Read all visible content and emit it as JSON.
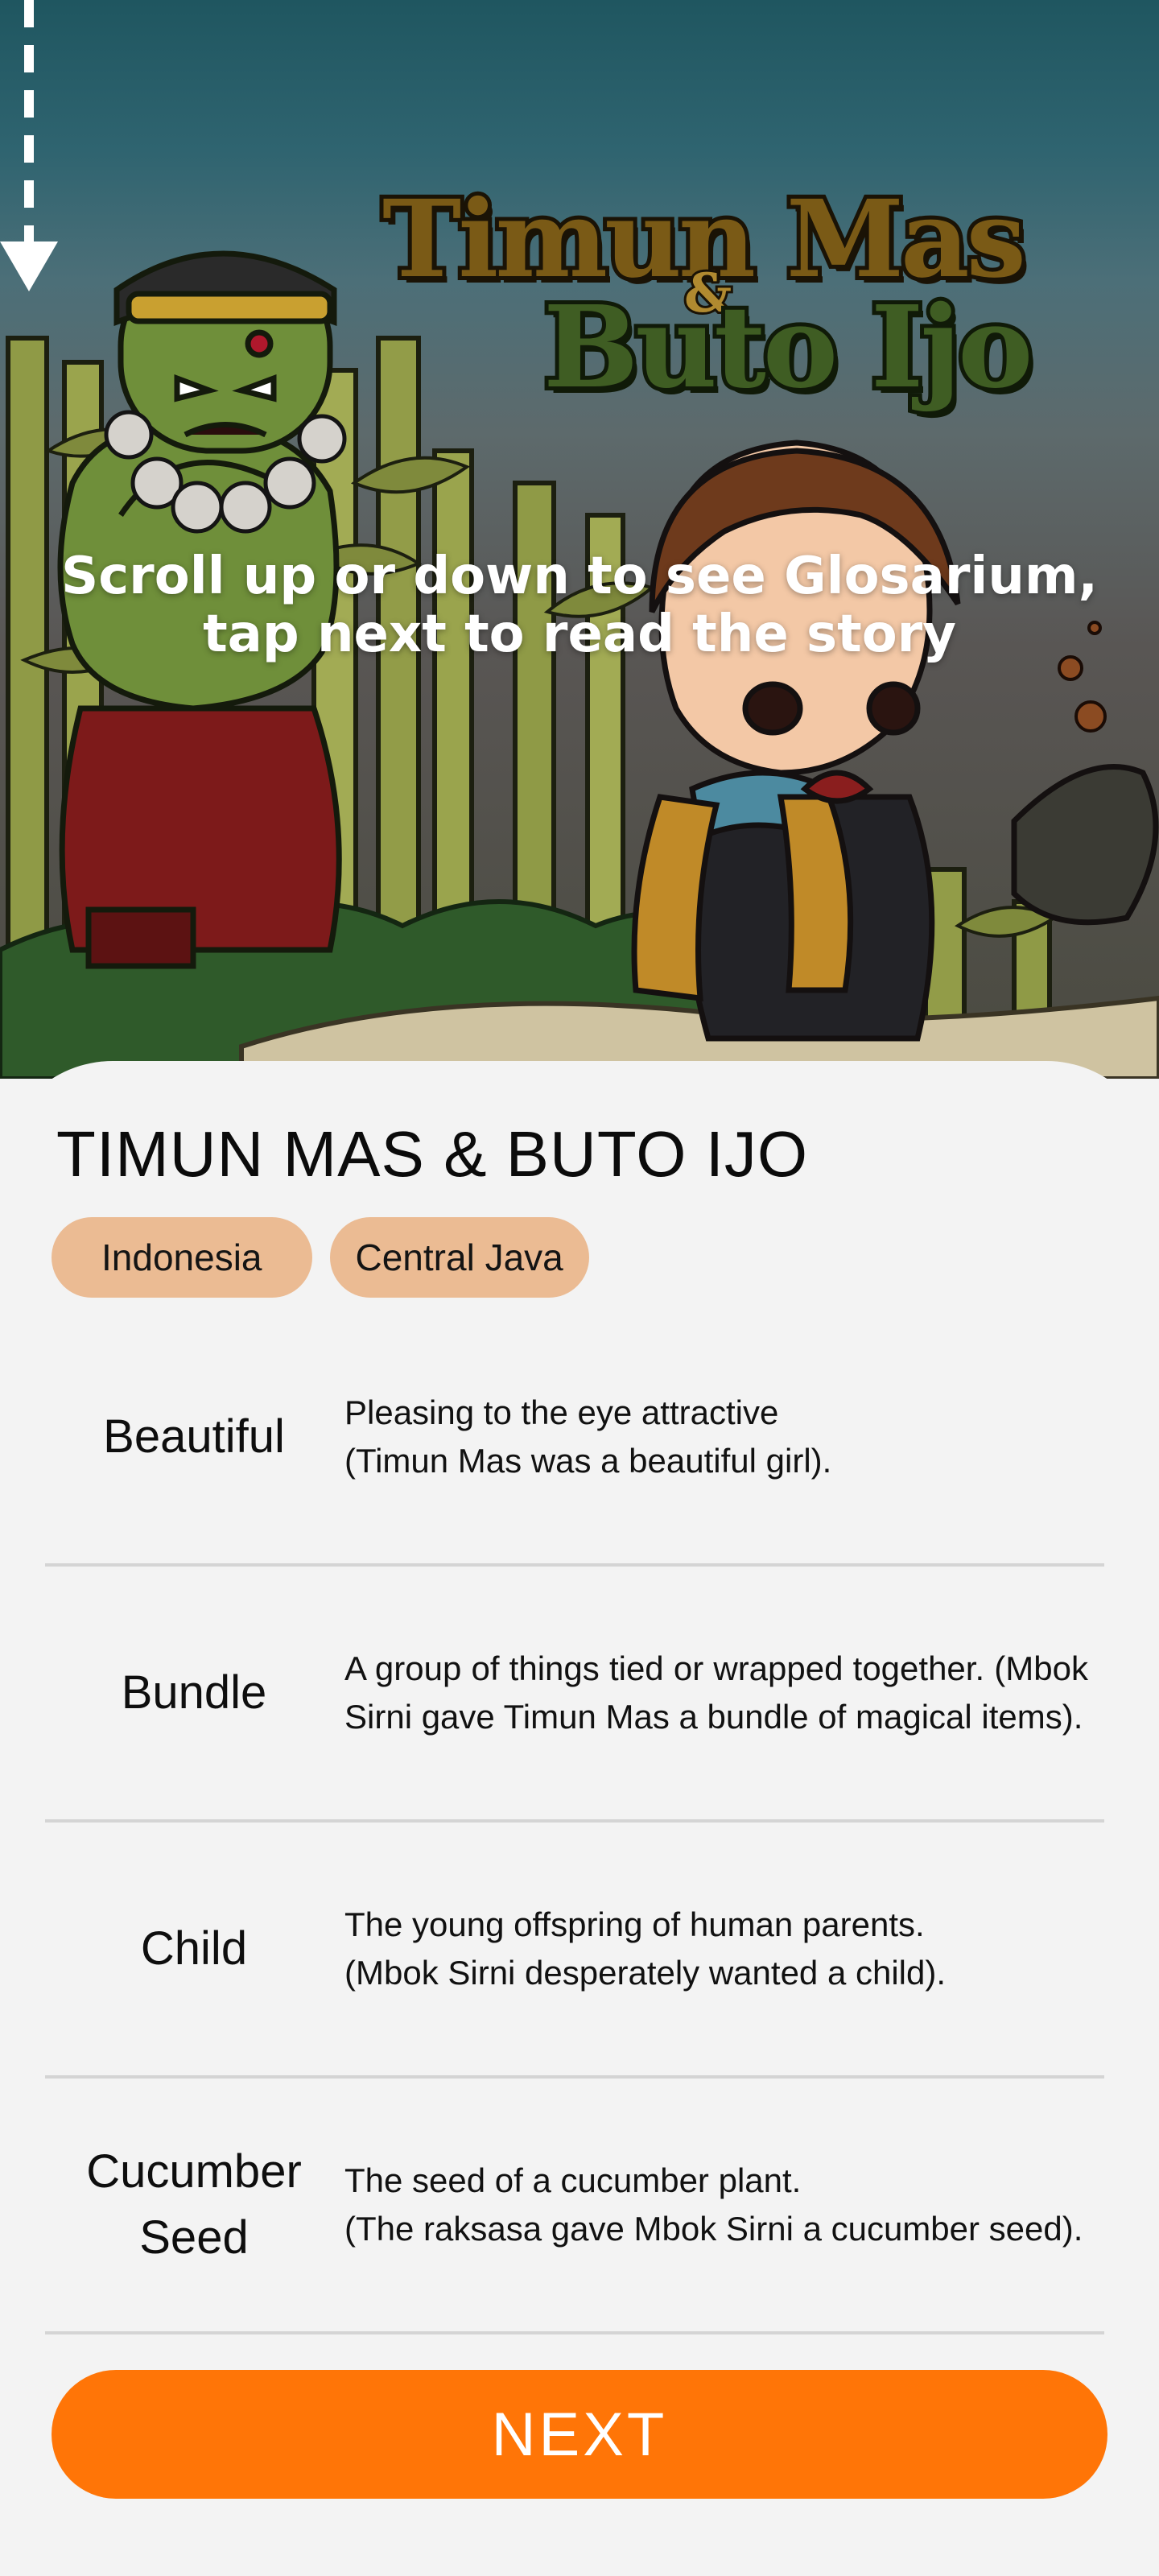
{
  "hero": {
    "logo": {
      "line1": "Timun Mas",
      "ampersand": "&",
      "line2": "Buto Ijo"
    },
    "instruction_line1": "Scroll up or down to see Glosarium,",
    "instruction_line2": "tap next to read the story",
    "arrow_icon": "dashed-down-arrow-icon"
  },
  "story": {
    "title": "TIMUN MAS & BUTO IJO",
    "tags": [
      "Indonesia",
      "Central Java"
    ]
  },
  "glossary": [
    {
      "term_lines": [
        "Beautiful"
      ],
      "definition_lines": [
        "Pleasing to the eye attractive",
        "(Timun Mas was a beautiful girl)."
      ]
    },
    {
      "term_lines": [
        "Bundle"
      ],
      "definition_lines": [
        "A group of things tied or wrapped together. (Mbok Sirni gave Timun Mas a bundle of magical items)."
      ]
    },
    {
      "term_lines": [
        "Child"
      ],
      "definition_lines": [
        "The young offspring of human parents.",
        "(Mbok Sirni desperately wanted a child)."
      ]
    },
    {
      "term_lines": [
        "Cucumber",
        "Seed"
      ],
      "definition_lines": [
        "The seed of a cucumber plant.",
        "(The raksasa gave Mbok Sirni a cucumber seed)."
      ]
    }
  ],
  "footer": {
    "next_label": "NEXT"
  },
  "colors": {
    "accent": "#ff7507",
    "tag_background": "#ebbb93",
    "sheet_background": "#f3f3f3",
    "hero_top": "#1f5660"
  }
}
